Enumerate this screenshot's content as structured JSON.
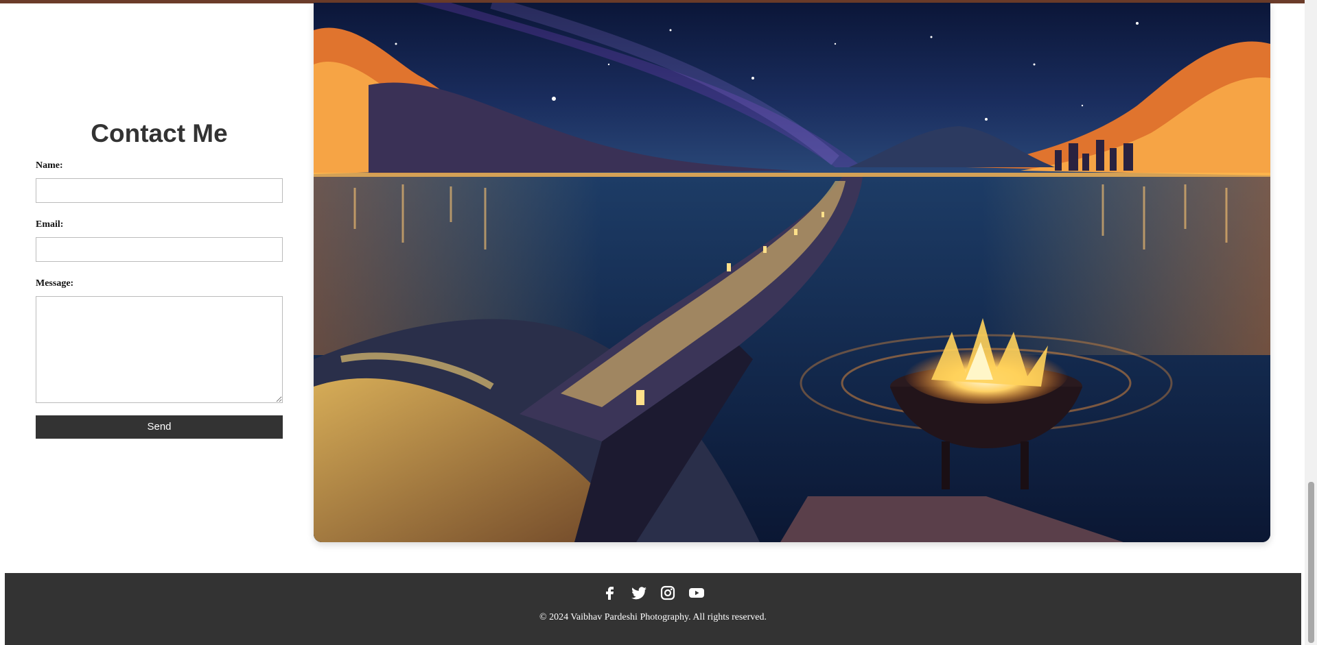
{
  "contact": {
    "title": "Contact Me",
    "name_label": "Name:",
    "name_value": "",
    "email_label": "Email:",
    "email_value": "",
    "message_label": "Message:",
    "message_value": "",
    "send_label": "Send"
  },
  "gallery": {
    "image_icon": "night-lake-landscape-illustration"
  },
  "footer": {
    "socials": [
      "facebook-icon",
      "twitter-icon",
      "instagram-icon",
      "youtube-icon"
    ],
    "copyright": "© 2024 Vaibhav Pardeshi Photography. All rights reserved."
  },
  "colors": {
    "accent_bar": "#6b3c2a",
    "footer_bg": "#333333",
    "button_bg": "#333333"
  }
}
